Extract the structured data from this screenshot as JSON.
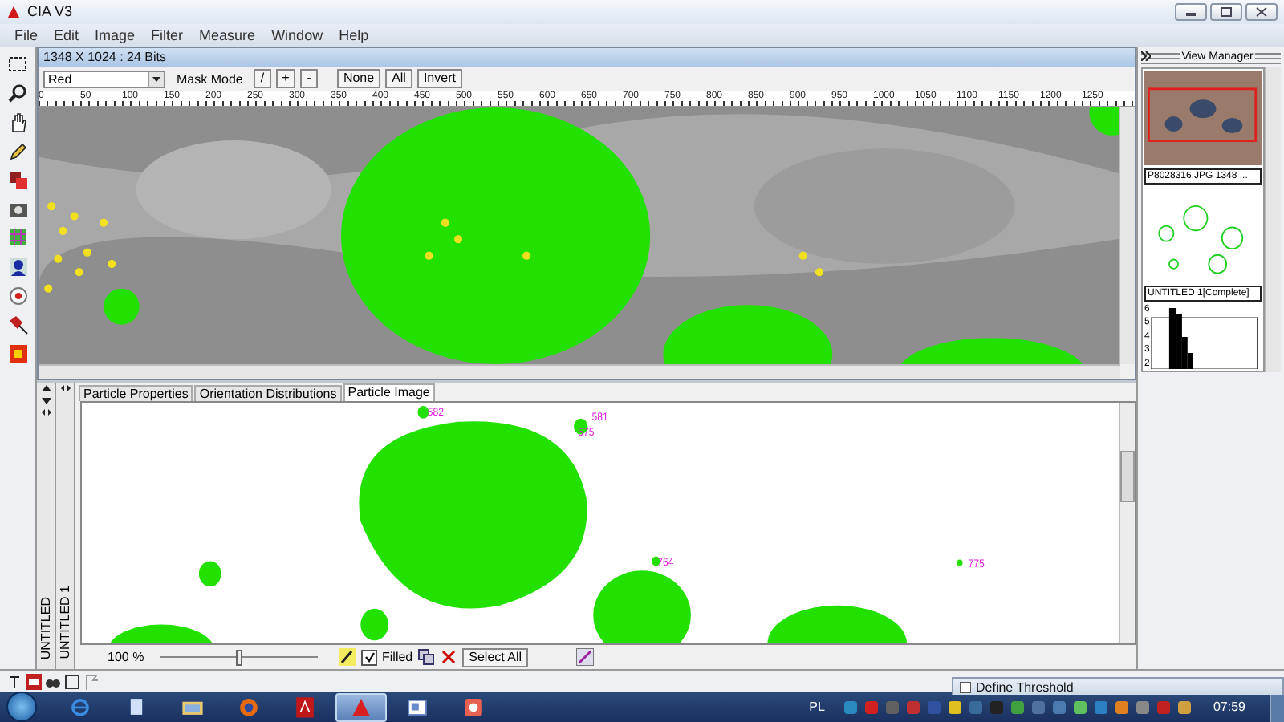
{
  "window": {
    "title": "CIA V3"
  },
  "menu": [
    "File",
    "Edit",
    "Image",
    "Filter",
    "Measure",
    "Window",
    "Help"
  ],
  "document": {
    "title": "1348 X 1024 : 24 Bits",
    "channel": "Red",
    "mask_mode_label": "Mask Mode",
    "mask_buttons": [
      "/",
      "+",
      "-"
    ],
    "buttons": [
      "None",
      "All",
      "Invert"
    ],
    "ruler_labels": [
      "0",
      "50",
      "100",
      "150",
      "200",
      "250",
      "300",
      "350",
      "400",
      "450",
      "500",
      "550",
      "600",
      "650",
      "700",
      "750",
      "800",
      "850",
      "900",
      "950",
      "1000",
      "1050",
      "1100",
      "1150",
      "1200",
      "1250"
    ]
  },
  "panel": {
    "tabs": [
      {
        "label": "Particle Properties",
        "selected": false
      },
      {
        "label": "Orientation Distributions",
        "selected": false
      },
      {
        "label": "Particle Image",
        "selected": true
      }
    ],
    "side_labels": [
      "UNTITLED",
      "UNTITLED 1"
    ],
    "particle_labels": [
      "582",
      "581",
      "575",
      "764",
      "775"
    ],
    "zoom": "100 %",
    "zoom_slider": {
      "level": 0.5
    },
    "filled": {
      "label": "Filled",
      "checked": true
    },
    "select_all": "Select All"
  },
  "view_manager": {
    "title": "View Manager",
    "items": [
      {
        "caption": "P8028316.JPG  1348 ..."
      },
      {
        "caption": "UNTITLED 1[Complete]"
      }
    ],
    "histogram_labels": [
      "6",
      "5",
      "4",
      "3",
      "2"
    ]
  },
  "dialog": {
    "title": "Define Threshold"
  },
  "taskbar": {
    "apps": [
      {
        "selected": false
      },
      {
        "selected": false
      },
      {
        "selected": false
      },
      {
        "selected": false
      },
      {
        "selected": false
      },
      {
        "selected": true
      },
      {
        "selected": false
      },
      {
        "selected": false
      }
    ],
    "language": "PL",
    "time": "07:59"
  }
}
